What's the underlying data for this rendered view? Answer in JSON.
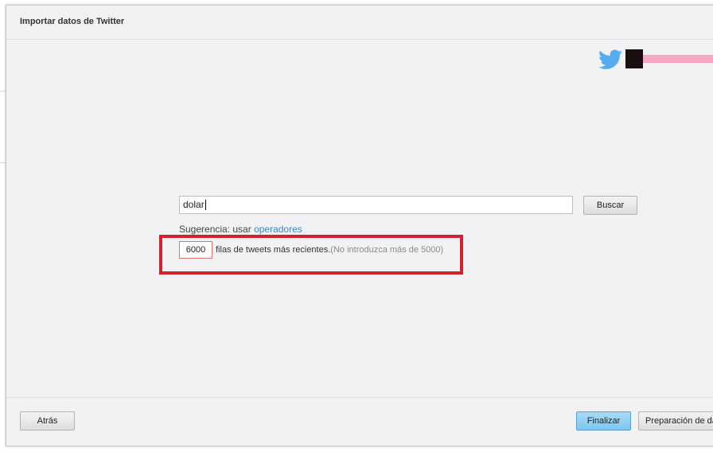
{
  "dialog": {
    "title": "Importar datos de Twitter"
  },
  "account": {
    "icon": "twitter-bird-icon",
    "brand_color": "#55acee"
  },
  "search": {
    "query": "dolar",
    "button_label": "Buscar"
  },
  "hint": {
    "prefix": "Sugerencia: usar ",
    "link_label": "operadores"
  },
  "rows": {
    "value": "6000",
    "label": "filas de tweets más recientes.",
    "note": "(No introduzca más de 5000)"
  },
  "footer": {
    "back_label": "Atrás",
    "finish_label": "Finalizar",
    "prep_label": "Preparación de da"
  },
  "colors": {
    "highlight": "#d0232d",
    "link": "#3a86c8",
    "primary_button": "#7fc5ef"
  }
}
